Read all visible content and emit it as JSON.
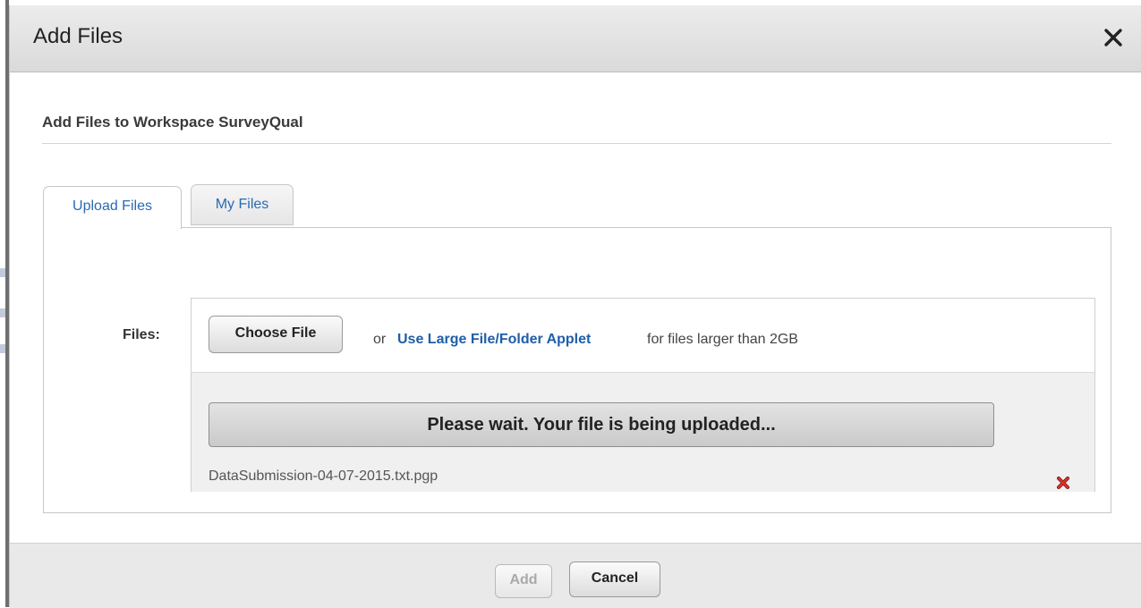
{
  "dialog": {
    "title": "Add Files",
    "subtitle": "Add Files to Workspace SurveyQual"
  },
  "tabs": [
    {
      "label": "Upload Files",
      "active": true
    },
    {
      "label": "My Files",
      "active": false
    }
  ],
  "upload": {
    "files_label": "Files:",
    "choose_file_label": "Choose File",
    "or_text": "or",
    "applet_link_text": "Use Large File/Folder Applet",
    "applet_note": "for files larger than 2GB",
    "progress_text": "Please wait. Your file is being uploaded...",
    "progress_fraction": 0,
    "file_name": "DataSubmission-04-07-2015.txt.pgp"
  },
  "footer": {
    "add_label": "Add",
    "add_disabled": true,
    "cancel_label": "Cancel"
  },
  "icons": {
    "close": "close-icon",
    "remove": "remove-file-icon"
  },
  "colors": {
    "link": "#1f5ea8",
    "tab_text": "#2a6ab1",
    "remove_icon": "#c0201a"
  }
}
